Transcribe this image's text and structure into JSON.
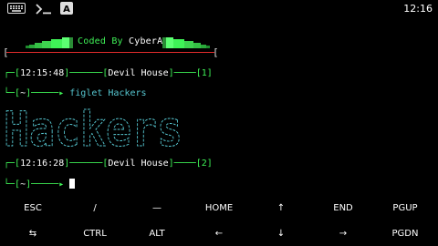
{
  "status_bar": {
    "icons": [
      "keyboard-icon",
      "terminal-icon",
      "app-a-icon"
    ],
    "a_letter": "A",
    "time": "12:16"
  },
  "banner": {
    "prefix": "Coded By ",
    "brand": "CyberAK",
    "left_bracket": "[",
    "right_bracket": "["
  },
  "prompt1": {
    "time": "12:15:48",
    "host": "Devil House",
    "num": "1",
    "dir": "~",
    "command": "figlet Hackers"
  },
  "figlet_output": {
    "text": "Hackers",
    "color": "#56c6d0"
  },
  "prompt2": {
    "time": "12:16:28",
    "host": "Devil House",
    "num": "2",
    "dir": "~"
  },
  "extra_keys": {
    "row1": [
      "ESC",
      "/",
      "—",
      "HOME",
      "↑",
      "END",
      "PGUP"
    ],
    "row2": [
      "⇆",
      "CTRL",
      "ALT",
      "←",
      "↓",
      "→",
      "PGDN"
    ]
  },
  "colors": {
    "background": "#000000",
    "prompt_green": "#3ff257",
    "command_cyan": "#56c6d0",
    "banner_red": "#e12b2b"
  }
}
